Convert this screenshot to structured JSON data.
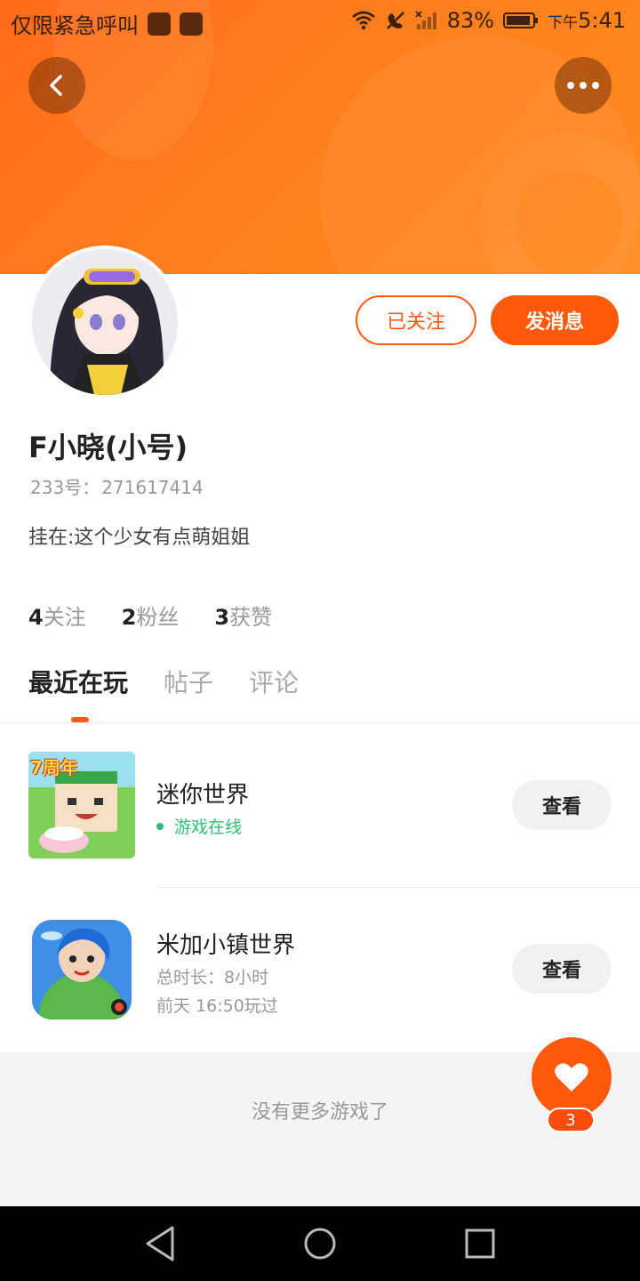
{
  "status_bar": {
    "carrier_text": "仅限紧急呼叫",
    "battery": "83%",
    "time_prefix": "下午",
    "time": "5:41"
  },
  "header": {
    "back_icon": "chevron-left-icon",
    "more_icon": "more-dots-icon"
  },
  "profile": {
    "name": "F小晓(小号)",
    "id_label": "233号：",
    "id_value": "271617414",
    "status": "挂在:这个少女有点萌姐姐",
    "follow_button": "已关注",
    "message_button": "发消息"
  },
  "stats": [
    {
      "num": "4",
      "label": "关注"
    },
    {
      "num": "2",
      "label": "粉丝"
    },
    {
      "num": "3",
      "label": "获赞"
    }
  ],
  "tabs": [
    "最近在玩",
    "帖子",
    "评论"
  ],
  "active_tab": "最近在玩",
  "games": [
    {
      "name": "迷你世界",
      "status": "游戏在线",
      "view": "查看",
      "badge": "7周年"
    },
    {
      "name": "米加小镇世界",
      "duration": "总时长：8小时",
      "last_played": "前天 16:50玩过",
      "view": "查看"
    }
  ],
  "footer": {
    "no_more": "没有更多游戏了"
  },
  "like": {
    "icon": "heart-icon",
    "count": "3"
  },
  "colors": {
    "accent": "#ff5a0c",
    "online": "#2fbf71"
  }
}
